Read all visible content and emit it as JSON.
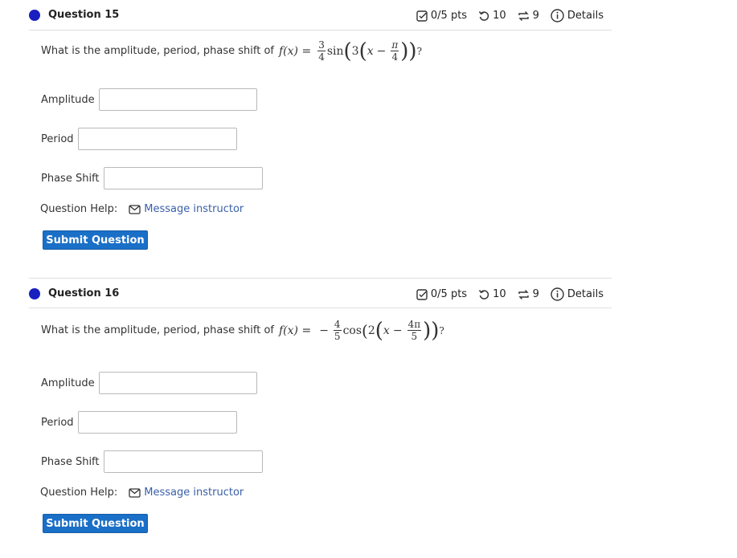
{
  "questions": [
    {
      "title": "Question 15",
      "points": "0/5 pts",
      "attempts": "10",
      "retries": "9",
      "details": "Details",
      "prompt_text": "What is the amplitude, period, phase shift of",
      "math": {
        "fname": "f(x) =",
        "coef_num": "3",
        "coef_den": "4",
        "func": "sin",
        "inner_coef": "3",
        "var": "x",
        "shift_num": "π",
        "shift_den": "4",
        "tail": "?"
      },
      "fields": [
        {
          "label": "Amplitude",
          "value": ""
        },
        {
          "label": "Period",
          "value": ""
        },
        {
          "label": "Phase Shift",
          "value": ""
        }
      ],
      "help_label": "Question Help:",
      "help_link": "Message instructor",
      "submit": "Submit Question"
    },
    {
      "title": "Question 16",
      "points": "0/5 pts",
      "attempts": "10",
      "retries": "9",
      "details": "Details",
      "prompt_text": "What is the amplitude, period, phase shift of",
      "math": {
        "fname": "f(x) =",
        "sign": "−",
        "coef_num": "4",
        "coef_den": "5",
        "func": "cos",
        "inner_coef": "2",
        "var": "x",
        "shift_num": "4π",
        "shift_den": "5",
        "tail": "?"
      },
      "fields": [
        {
          "label": "Amplitude",
          "value": ""
        },
        {
          "label": "Period",
          "value": ""
        },
        {
          "label": "Phase Shift",
          "value": ""
        }
      ],
      "help_label": "Question Help:",
      "help_link": "Message instructor",
      "submit": "Submit Question"
    }
  ]
}
